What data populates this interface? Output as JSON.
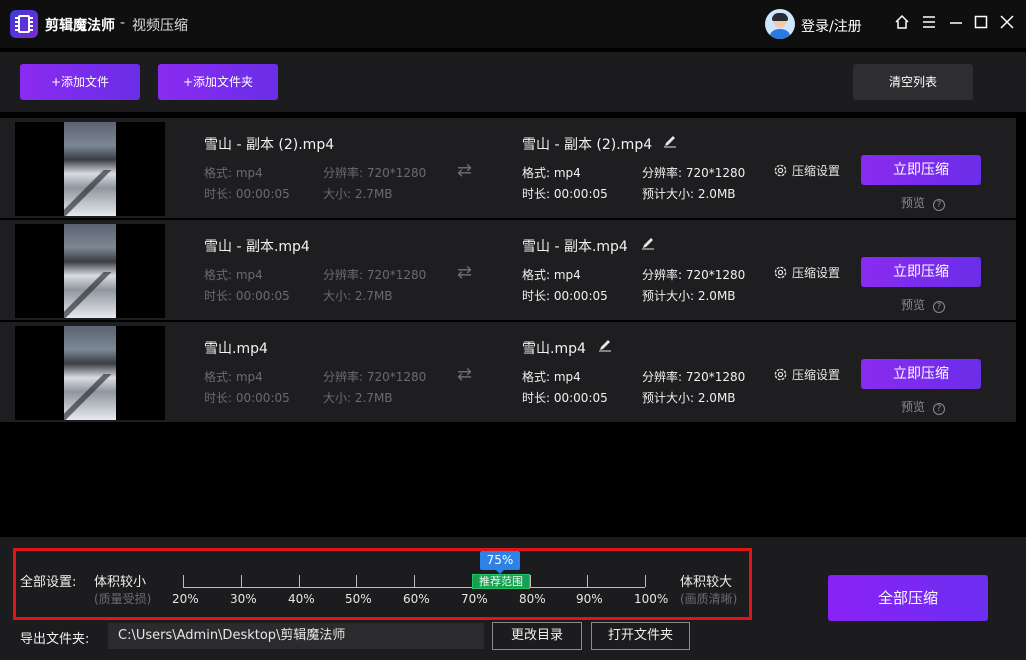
{
  "titlebar": {
    "app_name": "剪辑魔法师",
    "separator": "-",
    "module": "视频压缩",
    "login": "登录/注册"
  },
  "toolbar": {
    "add_file": "+添加文件",
    "add_folder": "+添加文件夹",
    "clear_list": "清空列表"
  },
  "files": [
    {
      "source": {
        "name": "雪山 - 副本 (2).mp4",
        "format": "格式: mp4",
        "resolution": "分辨率: 720*1280",
        "duration": "时长: 00:00:05",
        "size": "大小: 2.7MB"
      },
      "output": {
        "name": "雪山 - 副本 (2).mp4",
        "format": "格式: mp4",
        "resolution": "分辨率: 720*1280",
        "duration": "时长: 00:00:05",
        "size": "预计大小: 2.0MB"
      },
      "settings": "压缩设置",
      "compress": "立即压缩",
      "preview": "预览"
    },
    {
      "source": {
        "name": "雪山 - 副本.mp4",
        "format": "格式: mp4",
        "resolution": "分辨率: 720*1280",
        "duration": "时长: 00:00:05",
        "size": "大小: 2.7MB"
      },
      "output": {
        "name": "雪山 - 副本.mp4",
        "format": "格式: mp4",
        "resolution": "分辨率: 720*1280",
        "duration": "时长: 00:00:05",
        "size": "预计大小: 2.0MB"
      },
      "settings": "压缩设置",
      "compress": "立即压缩",
      "preview": "预览"
    },
    {
      "source": {
        "name": "雪山.mp4",
        "format": "格式: mp4",
        "resolution": "分辨率: 720*1280",
        "duration": "时长: 00:00:05",
        "size": "大小: 2.7MB"
      },
      "output": {
        "name": "雪山.mp4",
        "format": "格式: mp4",
        "resolution": "分辨率: 720*1280",
        "duration": "时长: 00:00:05",
        "size": "预计大小: 2.0MB"
      },
      "settings": "压缩设置",
      "compress": "立即压缩",
      "preview": "预览"
    }
  ],
  "global_settings": {
    "label": "全部设置:",
    "small_label": "体积较小",
    "small_sub": "(质量受损)",
    "large_label": "体积较大",
    "large_sub": "(画质清晰)",
    "ticks": [
      "20%",
      "30%",
      "40%",
      "50%",
      "60%",
      "70%",
      "80%",
      "90%",
      "100%"
    ],
    "current_value": "75%",
    "recommended_label": "推荐范围",
    "recommended_range": [
      70,
      80
    ]
  },
  "export": {
    "label": "导出文件夹:",
    "path": "C:\\Users\\Admin\\Desktop\\剪辑魔法师",
    "change_dir": "更改目录",
    "open_folder": "打开文件夹"
  },
  "compress_all": "全部压缩",
  "colors": {
    "accent_purple": "#8a2bf0",
    "badge_blue": "#2e82e6",
    "recommend_green": "#1a9e52",
    "highlight_red": "#e01515"
  }
}
